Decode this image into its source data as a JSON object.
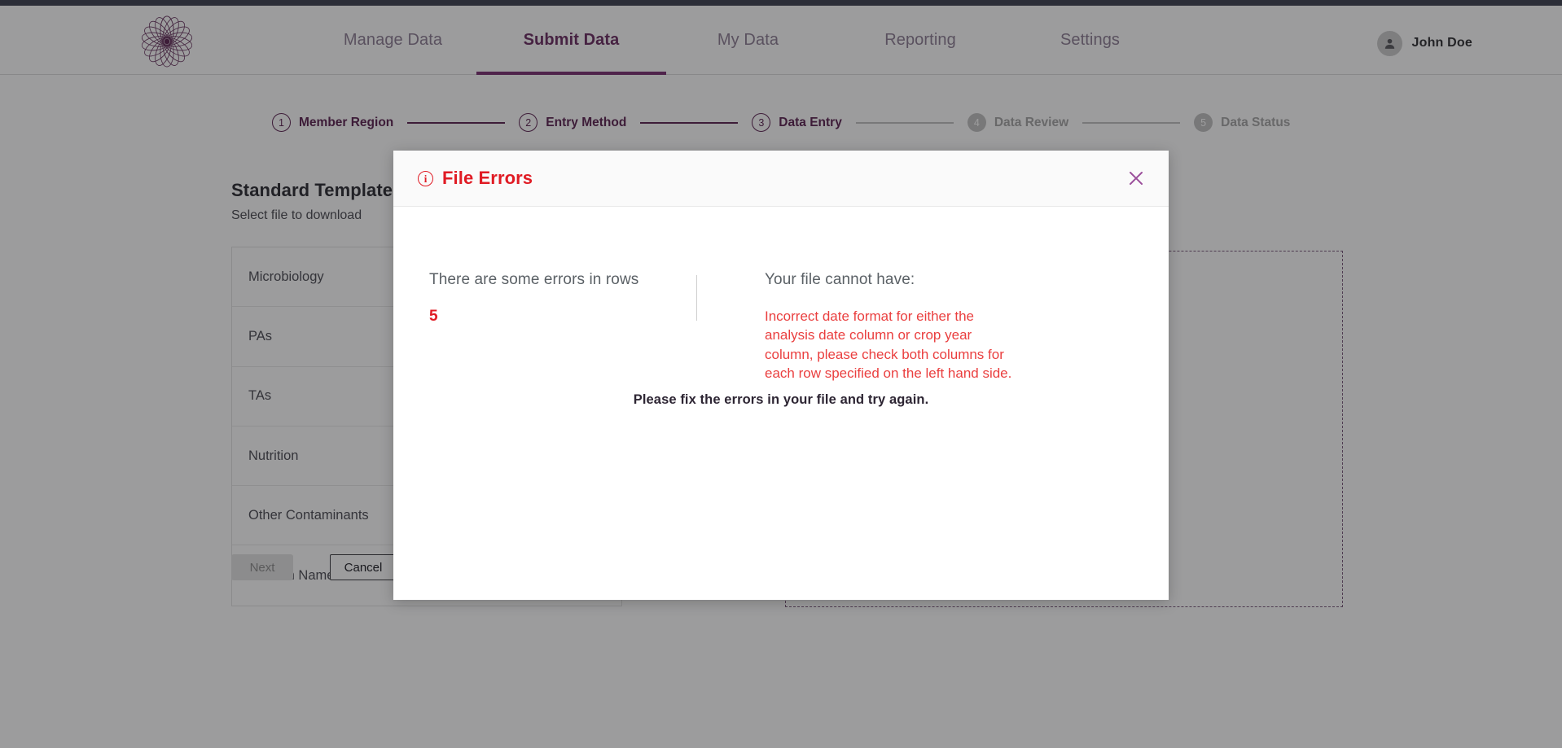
{
  "navbar": {
    "logo_icon": "mandala-flower-logo",
    "links": [
      {
        "id": "manage",
        "label": "Manage Data",
        "active": false
      },
      {
        "id": "submit",
        "label": "Submit Data",
        "active": true
      },
      {
        "id": "mydata",
        "label": "My Data",
        "active": false
      },
      {
        "id": "reporting",
        "label": "Reporting",
        "active": false
      },
      {
        "id": "settings",
        "label": "Settings",
        "active": false
      }
    ],
    "user": {
      "name": "John Doe",
      "avatar_icon": "user-avatar-icon"
    }
  },
  "stepper": {
    "steps": [
      {
        "number": "1",
        "label": "Member Region",
        "state": "done"
      },
      {
        "number": "2",
        "label": "Entry Method",
        "state": "done"
      },
      {
        "number": "3",
        "label": "Data Entry",
        "state": "current"
      },
      {
        "number": "4",
        "label": "Data Review",
        "state": "todo"
      },
      {
        "number": "5",
        "label": "Data Status",
        "state": "todo"
      }
    ]
  },
  "section": {
    "title": "Standard Template",
    "subtitle": "Select file to download"
  },
  "templates": {
    "rows": [
      {
        "label": "Microbiology"
      },
      {
        "label": "PAs"
      },
      {
        "label": "TAs"
      },
      {
        "label": "Nutrition"
      },
      {
        "label": "Other Contaminants"
      },
      {
        "label": "Custom Name"
      }
    ]
  },
  "dropzone": {
    "name": "file-upload-dropzone"
  },
  "footer": {
    "next_label": "Next",
    "cancel_label": "Cancel"
  },
  "modal": {
    "title": "File Errors",
    "info_icon_glyph": "i",
    "close_icon": "close-x-icon",
    "left": {
      "heading": "There are some errors in rows",
      "rows": "5"
    },
    "right": {
      "heading": "Your file cannot have:",
      "message": "Incorrect date format for either the analysis date column or crop year column, please check both columns for each row specified on the left hand side."
    },
    "footnote": "Please fix the errors in your file and try again."
  },
  "colors": {
    "brand_purple": "#5c2352",
    "nav_inactive": "#8e7f95",
    "error_red": "#e01b24",
    "error_text_red": "#ea3f3f",
    "top_strip": "#3e4351",
    "dropzone_border": "#7a5a7d"
  }
}
